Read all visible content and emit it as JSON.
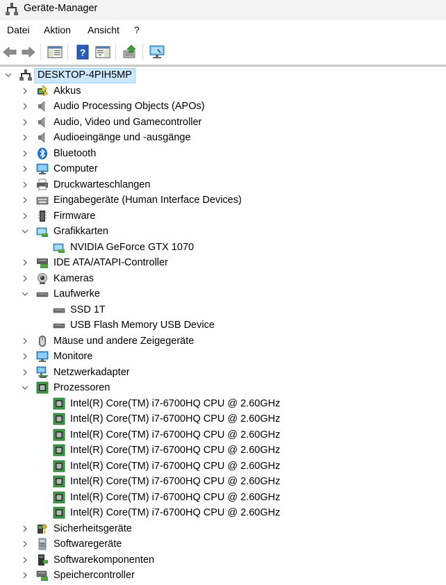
{
  "window": {
    "title": "Geräte-Manager"
  },
  "menu": [
    {
      "label": "Datei"
    },
    {
      "label": "Aktion"
    },
    {
      "label": "Ansicht"
    },
    {
      "label": "?"
    }
  ],
  "toolbar": {
    "buttons": [
      {
        "name": "back-button",
        "icon": "arrow-left-icon"
      },
      {
        "name": "forward-button",
        "icon": "arrow-right-icon"
      },
      {
        "name": "show-hide-console-tree-button",
        "icon": "console-tree-icon"
      },
      {
        "name": "help-button",
        "icon": "help-icon"
      },
      {
        "name": "action-pane-button",
        "icon": "action-pane-icon"
      },
      {
        "name": "update-driver-button",
        "icon": "update-driver-icon"
      },
      {
        "name": "scan-hardware-button",
        "icon": "scan-monitor-icon"
      }
    ]
  },
  "tree": {
    "root": {
      "label": "DESKTOP-4PIH5MP",
      "icon": "computer-tree-icon",
      "expanded": true
    },
    "items": [
      {
        "label": "Akkus",
        "icon": "battery-icon",
        "expanded": false
      },
      {
        "label": "Audio Processing Objects (APOs)",
        "icon": "speaker-icon",
        "expanded": false
      },
      {
        "label": "Audio, Video und Gamecontroller",
        "icon": "speaker-icon",
        "expanded": false
      },
      {
        "label": "Audioeingänge und -ausgänge",
        "icon": "speaker-icon",
        "expanded": false
      },
      {
        "label": "Bluetooth",
        "icon": "bluetooth-icon",
        "expanded": false
      },
      {
        "label": "Computer",
        "icon": "monitor-icon",
        "expanded": false
      },
      {
        "label": "Druckwarteschlangen",
        "icon": "printer-icon",
        "expanded": false
      },
      {
        "label": "Eingabegeräte (Human Interface Devices)",
        "icon": "keyboard-icon",
        "expanded": false
      },
      {
        "label": "Firmware",
        "icon": "firmware-icon",
        "expanded": false
      },
      {
        "label": "Grafikkarten",
        "icon": "display-adapter-icon",
        "expanded": true,
        "children": [
          {
            "label": "NVIDIA GeForce GTX 1070",
            "icon": "display-adapter-icon"
          }
        ]
      },
      {
        "label": "IDE ATA/ATAPI-Controller",
        "icon": "ide-controller-icon",
        "expanded": false
      },
      {
        "label": "Kameras",
        "icon": "camera-icon",
        "expanded": false
      },
      {
        "label": "Laufwerke",
        "icon": "drive-icon",
        "expanded": true,
        "children": [
          {
            "label": "SSD 1T",
            "icon": "drive-icon"
          },
          {
            "label": "USB Flash Memory USB Device",
            "icon": "drive-icon"
          }
        ]
      },
      {
        "label": "Mäuse und andere Zeigegeräte",
        "icon": "mouse-icon",
        "expanded": false
      },
      {
        "label": "Monitore",
        "icon": "monitor-icon",
        "expanded": false
      },
      {
        "label": "Netzwerkadapter",
        "icon": "network-icon",
        "expanded": false
      },
      {
        "label": "Prozessoren",
        "icon": "processor-icon",
        "expanded": true,
        "children": [
          {
            "label": "Intel(R) Core(TM) i7-6700HQ CPU @ 2.60GHz",
            "icon": "processor-icon"
          },
          {
            "label": "Intel(R) Core(TM) i7-6700HQ CPU @ 2.60GHz",
            "icon": "processor-icon"
          },
          {
            "label": "Intel(R) Core(TM) i7-6700HQ CPU @ 2.60GHz",
            "icon": "processor-icon"
          },
          {
            "label": "Intel(R) Core(TM) i7-6700HQ CPU @ 2.60GHz",
            "icon": "processor-icon"
          },
          {
            "label": "Intel(R) Core(TM) i7-6700HQ CPU @ 2.60GHz",
            "icon": "processor-icon"
          },
          {
            "label": "Intel(R) Core(TM) i7-6700HQ CPU @ 2.60GHz",
            "icon": "processor-icon"
          },
          {
            "label": "Intel(R) Core(TM) i7-6700HQ CPU @ 2.60GHz",
            "icon": "processor-icon"
          },
          {
            "label": "Intel(R) Core(TM) i7-6700HQ CPU @ 2.60GHz",
            "icon": "processor-icon"
          }
        ]
      },
      {
        "label": "Sicherheitsgeräte",
        "icon": "security-device-icon",
        "expanded": false
      },
      {
        "label": "Softwaregeräte",
        "icon": "software-device-icon",
        "expanded": false
      },
      {
        "label": "Softwarekomponenten",
        "icon": "software-component-icon",
        "expanded": false
      },
      {
        "label": "Speichercontroller",
        "icon": "storage-controller-icon",
        "expanded": false
      }
    ]
  }
}
